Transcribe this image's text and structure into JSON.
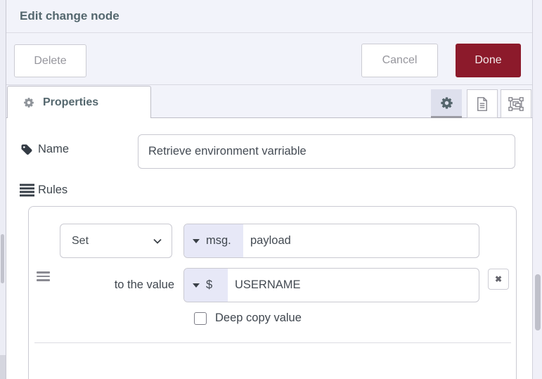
{
  "window": {
    "title": "Edit change node"
  },
  "toolbar": {
    "delete_label": "Delete",
    "cancel_label": "Cancel",
    "done_label": "Done"
  },
  "tabbar": {
    "properties_label": "Properties",
    "icon_buttons": [
      {
        "name": "properties-gear",
        "selected": true
      },
      {
        "name": "description-document",
        "selected": false
      },
      {
        "name": "appearance-group",
        "selected": false
      }
    ]
  },
  "form": {
    "name_label": "Name",
    "name_value": "Retrieve environment varriable",
    "rules_label": "Rules"
  },
  "rule": {
    "action": "Set",
    "property_type": "msg.",
    "property_value": "payload",
    "to_label": "to the value",
    "value_type": "$",
    "value_text": "USERNAME",
    "deep_copy_label": "Deep copy value",
    "remove_glyph": "✖"
  },
  "colors": {
    "done_button": "#8C1A2B",
    "panel_background": "#F2F3FA",
    "type_prefix_background": "#E7E8F7",
    "heading_text": "#54676E"
  }
}
